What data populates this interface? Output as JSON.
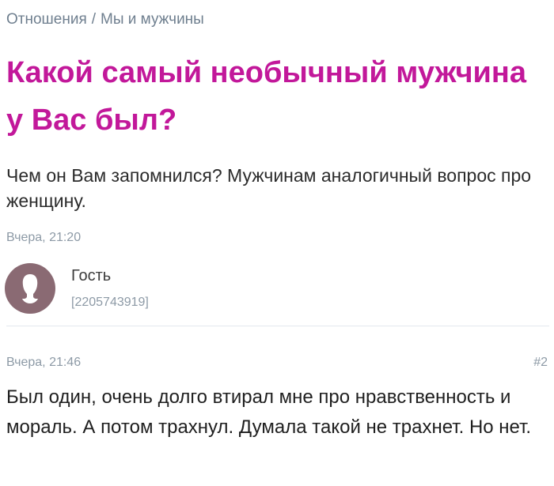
{
  "breadcrumb": {
    "parent": "Отношения",
    "separator": "/",
    "current": "Мы и мужчины"
  },
  "question": {
    "title": "Какой самый необычный мужчина у Вас был?",
    "text": "Чем он Вам запомнился? Мужчинам аналогичный вопрос про женщину.",
    "date": "Вчера, 21:20",
    "author": {
      "name": "Гость",
      "id": "[2205743919]",
      "avatar_icon": "user-silhouette-icon",
      "avatar_color": "#8a6a73"
    }
  },
  "answer": {
    "date": "Вчера, 21:46",
    "number": "#2",
    "text": "Был один, очень долго втирал мне про нравственность и мораль. А потом трахнул. Думала такой не трахнет. Но нет."
  },
  "colors": {
    "title": "#c2189a",
    "muted": "#8d9aa6",
    "breadcrumb": "#6f7f8f"
  }
}
